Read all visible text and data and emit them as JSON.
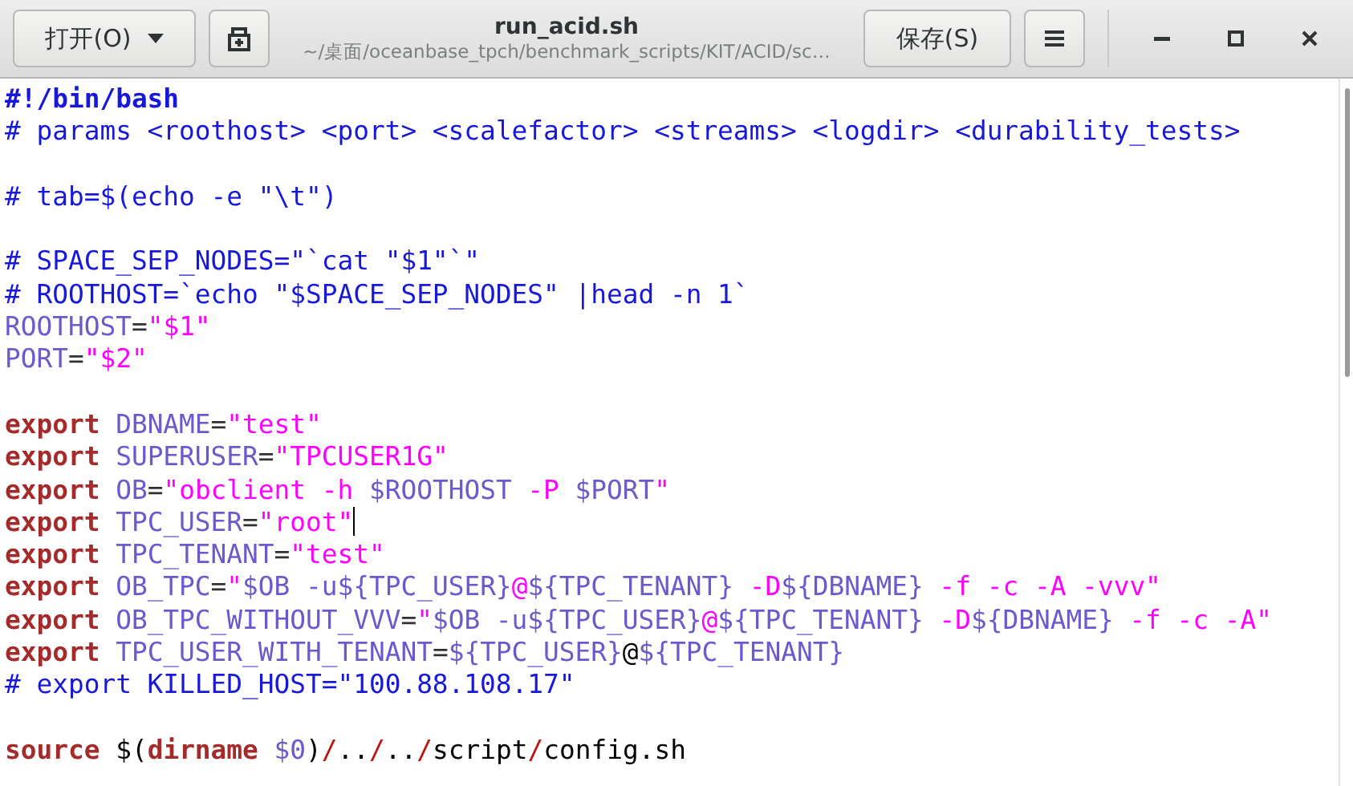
{
  "window": {
    "title": "run_acid.sh",
    "subtitle": "~/桌面/oceanbase_tpch/benchmark_scripts/KIT/ACID/sc…"
  },
  "toolbar": {
    "open_button": "打开(O)",
    "save_button": "保存(S)"
  },
  "editor": {
    "lines": [
      {
        "kind": "code",
        "cursor": false,
        "tokens": [
          {
            "kind": "shebang",
            "text": "#!/bin/bash"
          }
        ]
      },
      {
        "kind": "code",
        "cursor": false,
        "tokens": [
          {
            "kind": "comment",
            "text": "# params <roothost> <port> <scalefactor> <streams> <logdir> <durability_tests>"
          }
        ]
      },
      {
        "kind": "blank"
      },
      {
        "kind": "code",
        "cursor": false,
        "tokens": [
          {
            "kind": "comment",
            "text": "# tab=$(echo -e \"\\t\")"
          }
        ]
      },
      {
        "kind": "blank"
      },
      {
        "kind": "code",
        "cursor": false,
        "tokens": [
          {
            "kind": "comment",
            "text": "# SPACE_SEP_NODES=\"`cat \"$1\"`\""
          }
        ]
      },
      {
        "kind": "code",
        "cursor": false,
        "tokens": [
          {
            "kind": "comment",
            "text": "# ROOTHOST=`echo \"$SPACE_SEP_NODES\" |head -n 1`"
          }
        ]
      },
      {
        "kind": "code",
        "cursor": false,
        "tokens": [
          {
            "kind": "variable",
            "text": "ROOTHOST"
          },
          {
            "kind": "operator",
            "text": "="
          },
          {
            "kind": "string",
            "text": "\"$1\""
          }
        ]
      },
      {
        "kind": "code",
        "cursor": false,
        "tokens": [
          {
            "kind": "variable",
            "text": "PORT"
          },
          {
            "kind": "operator",
            "text": "="
          },
          {
            "kind": "string",
            "text": "\"$2\""
          }
        ]
      },
      {
        "kind": "blank"
      },
      {
        "kind": "code",
        "cursor": false,
        "tokens": [
          {
            "kind": "keyword",
            "text": "export "
          },
          {
            "kind": "variable",
            "text": "DBNAME"
          },
          {
            "kind": "operator",
            "text": "="
          },
          {
            "kind": "string",
            "text": "\"test\""
          }
        ]
      },
      {
        "kind": "code",
        "cursor": false,
        "tokens": [
          {
            "kind": "keyword",
            "text": "export "
          },
          {
            "kind": "variable",
            "text": "SUPERUSER"
          },
          {
            "kind": "operator",
            "text": "="
          },
          {
            "kind": "string",
            "text": "\"TPCUSER1G\""
          }
        ]
      },
      {
        "kind": "code",
        "cursor": false,
        "tokens": [
          {
            "kind": "keyword",
            "text": "export "
          },
          {
            "kind": "variable",
            "text": "OB"
          },
          {
            "kind": "operator",
            "text": "="
          },
          {
            "kind": "string",
            "text": "\"obclient -h "
          },
          {
            "kind": "variable",
            "text": "$ROOTHOST"
          },
          {
            "kind": "string",
            "text": " -P "
          },
          {
            "kind": "variable",
            "text": "$PORT"
          },
          {
            "kind": "string",
            "text": "\""
          }
        ]
      },
      {
        "kind": "code",
        "cursor": true,
        "tokens": [
          {
            "kind": "keyword",
            "text": "export "
          },
          {
            "kind": "variable",
            "text": "TPC_USER"
          },
          {
            "kind": "operator",
            "text": "="
          },
          {
            "kind": "string",
            "text": "\"root\""
          }
        ]
      },
      {
        "kind": "code",
        "cursor": false,
        "tokens": [
          {
            "kind": "keyword",
            "text": "export "
          },
          {
            "kind": "variable",
            "text": "TPC_TENANT"
          },
          {
            "kind": "operator",
            "text": "="
          },
          {
            "kind": "string",
            "text": "\"test\""
          }
        ]
      },
      {
        "kind": "code",
        "cursor": false,
        "tokens": [
          {
            "kind": "keyword",
            "text": "export "
          },
          {
            "kind": "variable",
            "text": "OB_TPC"
          },
          {
            "kind": "operator",
            "text": "="
          },
          {
            "kind": "string",
            "text": "\""
          },
          {
            "kind": "variable",
            "text": "$OB -u${TPC_USER}"
          },
          {
            "kind": "string",
            "text": "@"
          },
          {
            "kind": "variable",
            "text": "${TPC_TENANT}"
          },
          {
            "kind": "string",
            "text": " -D"
          },
          {
            "kind": "variable",
            "text": "${DBNAME}"
          },
          {
            "kind": "string",
            "text": " -f -c -A -vvv\""
          }
        ]
      },
      {
        "kind": "code",
        "cursor": false,
        "tokens": [
          {
            "kind": "keyword",
            "text": "export "
          },
          {
            "kind": "variable",
            "text": "OB_TPC_WITHOUT_VVV"
          },
          {
            "kind": "operator",
            "text": "="
          },
          {
            "kind": "string",
            "text": "\""
          },
          {
            "kind": "variable",
            "text": "$OB -u${TPC_USER}"
          },
          {
            "kind": "string",
            "text": "@"
          },
          {
            "kind": "variable",
            "text": "${TPC_TENANT}"
          },
          {
            "kind": "string",
            "text": " -D"
          },
          {
            "kind": "variable",
            "text": "${DBNAME}"
          },
          {
            "kind": "string",
            "text": " -f -c -A\""
          }
        ]
      },
      {
        "kind": "code",
        "cursor": false,
        "tokens": [
          {
            "kind": "keyword",
            "text": "export "
          },
          {
            "kind": "variable",
            "text": "TPC_USER_WITH_TENANT"
          },
          {
            "kind": "operator",
            "text": "="
          },
          {
            "kind": "variable",
            "text": "${TPC_USER}"
          },
          {
            "kind": "plain",
            "text": "@"
          },
          {
            "kind": "variable",
            "text": "${TPC_TENANT}"
          }
        ]
      },
      {
        "kind": "code",
        "cursor": false,
        "tokens": [
          {
            "kind": "comment",
            "text": "# export KILLED_HOST=\"100.88.108.17\""
          }
        ]
      },
      {
        "kind": "blank"
      },
      {
        "kind": "code",
        "cursor": false,
        "tokens": [
          {
            "kind": "keyword",
            "text": "source"
          },
          {
            "kind": "plain",
            "text": " $("
          },
          {
            "kind": "keyword",
            "text": "dirname "
          },
          {
            "kind": "variable",
            "text": "$0"
          },
          {
            "kind": "plain",
            "text": ")"
          },
          {
            "kind": "separator",
            "text": "/"
          },
          {
            "kind": "plain",
            "text": ".."
          },
          {
            "kind": "separator",
            "text": "/"
          },
          {
            "kind": "plain",
            "text": ".."
          },
          {
            "kind": "separator",
            "text": "/"
          },
          {
            "kind": "plain",
            "text": "script"
          },
          {
            "kind": "separator",
            "text": "/"
          },
          {
            "kind": "plain",
            "text": "config.sh"
          }
        ]
      }
    ]
  }
}
